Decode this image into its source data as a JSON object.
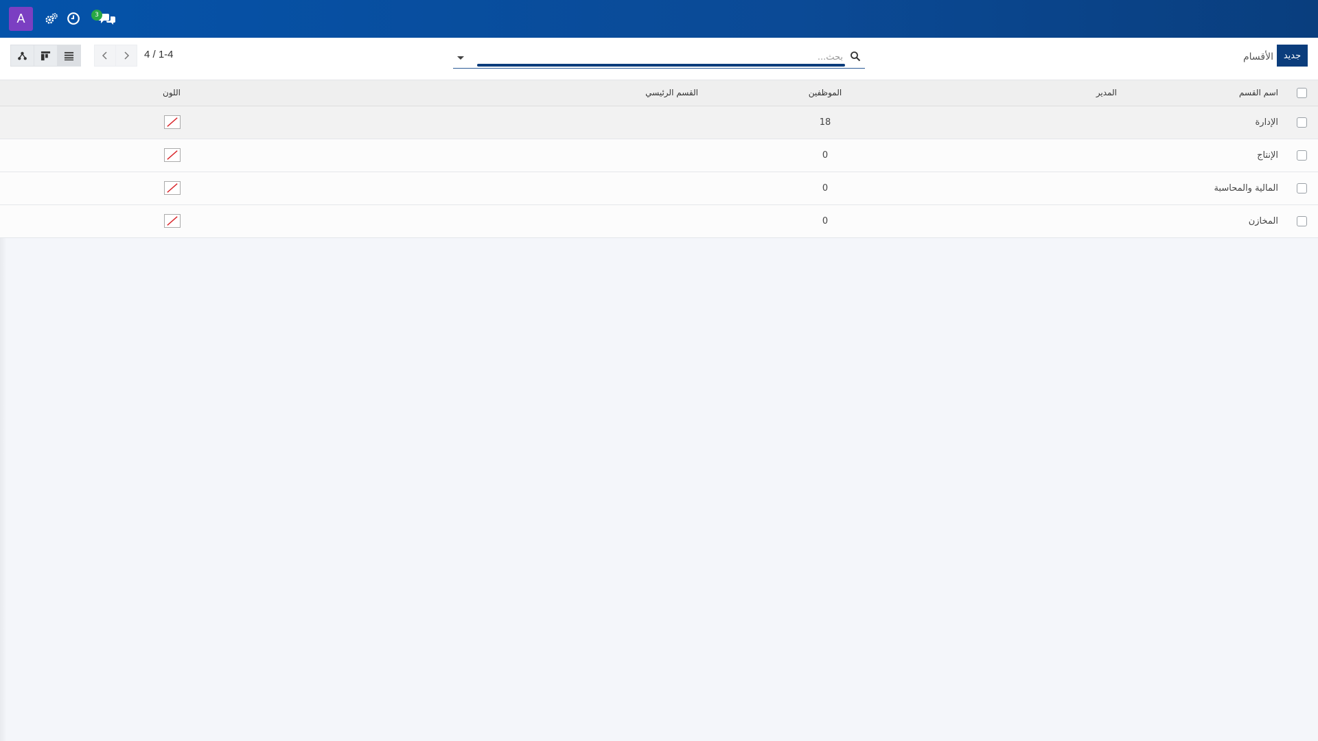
{
  "navbar": {
    "avatar_letter": "A",
    "icons": [
      "settings-cogs-icon",
      "clock-icon",
      "chat-icon"
    ],
    "chat_badge": "3",
    "background": "#0453aa"
  },
  "control": {
    "breadcrumb": "الأقسام",
    "new_button": "جديد",
    "search_placeholder": "بحث...",
    "pager": "4 / 1-4",
    "views": [
      "hierarchy-icon",
      "kanban-icon",
      "list-icon"
    ]
  },
  "table": {
    "columns": [
      "اسم القسم",
      "المدير",
      "الموظفين",
      "القسم الرئيسي",
      "اللون"
    ],
    "rows": [
      {
        "name": "الإدارة",
        "manager": "",
        "employees": "18",
        "parent": ""
      },
      {
        "name": "الإنتاج",
        "manager": "",
        "employees": "0",
        "parent": ""
      },
      {
        "name": "المالية والمحاسبة",
        "manager": "",
        "employees": "0",
        "parent": ""
      },
      {
        "name": "المخازن",
        "manager": "",
        "employees": "0",
        "parent": ""
      }
    ]
  },
  "colors": {
    "accent": "#0b3d7c",
    "avatar": "#7b3fc2",
    "badge": "#28a745",
    "swatch_slash": "#d9262b"
  }
}
